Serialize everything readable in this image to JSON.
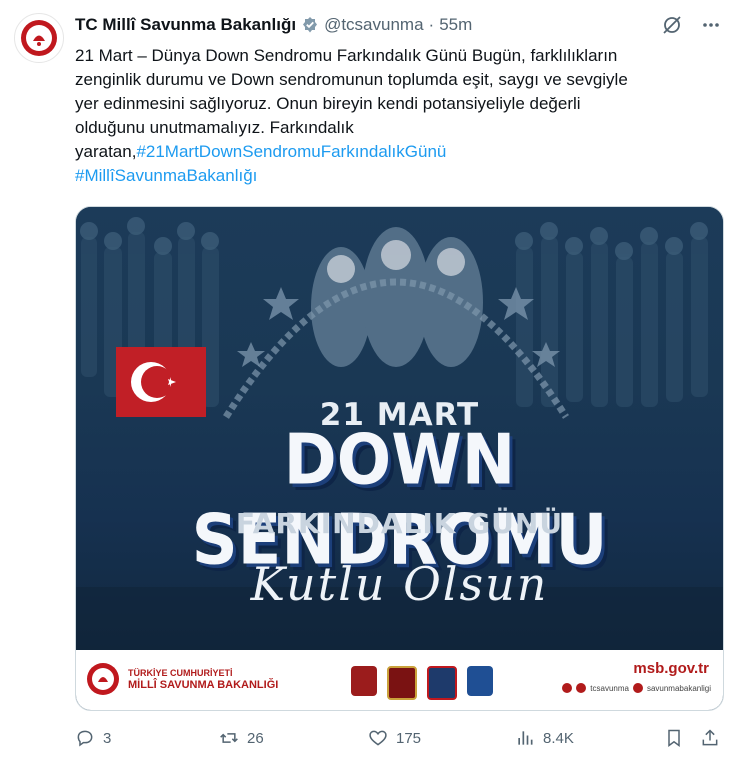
{
  "tweet": {
    "author_name": "TC Millî Savunma Bakanlığı",
    "handle": "@tcsavunma",
    "separator": "·",
    "time": "55m",
    "text_lines": [
      "21 Mart – Dünya Down Sendromu Farkındalık Günü Bugün, farklılıkların",
      "zenginlik durumu ve Down sendromunun toplumda eşit, saygı ve sevgiyle",
      "yer edinmesini sağlıyoruz. Onun bireyin kendi potansiyeliyle değerli",
      "olduğunu unutmamalıyız. Farkındalık"
    ],
    "text_prefix": "yaratan,",
    "hashtag1": "#21MartDownSendromuFarkındalıkGünü",
    "hashtag2": "#MillîSavunmaBakanlığı"
  },
  "media": {
    "date": "21 MART",
    "title": "DOWN SENDROMU",
    "subtitle": "FARKINDALIK GÜNÜ",
    "greeting": "Kutlu Olsun",
    "org_line1": "TÜRKİYE CUMHURİYETİ",
    "org_line2": "MİLLÎ SAVUNMA BAKANLIĞI",
    "website": "msb.gov.tr",
    "social_handle1": "tcsavunma",
    "social_handle2": "savunmabakanligi"
  },
  "actions": {
    "replies": "3",
    "reposts": "26",
    "likes": "175",
    "views": "8.4K"
  },
  "colors": {
    "link": "#1d9bf0",
    "secondary_text": "#536471",
    "brand_red": "#b11b1b"
  },
  "icons": [
    "verified-badge-icon",
    "grok-icon",
    "more-icon",
    "reply-icon",
    "repost-icon",
    "like-icon",
    "views-icon",
    "bookmark-icon",
    "share-icon"
  ]
}
